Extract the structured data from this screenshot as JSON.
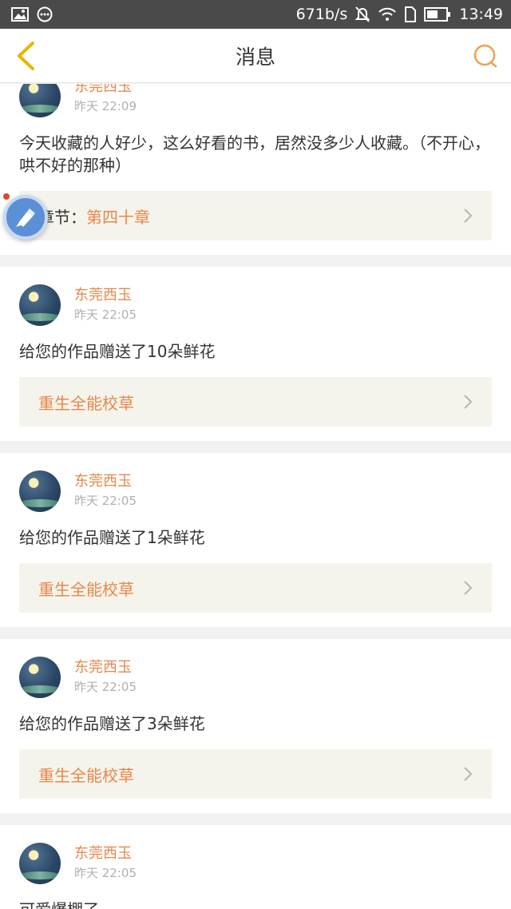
{
  "status_bar": {
    "speed": "671b/s",
    "time": "13:49"
  },
  "header": {
    "title": "消息"
  },
  "colors": {
    "accent": "#e8874a",
    "icon_yellow": "#e6b800",
    "search_orange": "#f0a050"
  },
  "messages": [
    {
      "author": "东莞西玉",
      "time": "昨天 22:09",
      "text": "今天收藏的人好少，这么好看的书，居然没多少人收藏。（不开心，哄不好的那种）",
      "link_label": "章节：",
      "link_value": "第四十章"
    },
    {
      "author": "东莞西玉",
      "time": "昨天 22:05",
      "text": "给您的作品赠送了10朵鲜花",
      "link": "重生全能校草"
    },
    {
      "author": "东莞西玉",
      "time": "昨天 22:05",
      "text": "给您的作品赠送了1朵鲜花",
      "link": "重生全能校草"
    },
    {
      "author": "东莞西玉",
      "time": "昨天 22:05",
      "text": "给您的作品赠送了3朵鲜花",
      "link": "重生全能校草"
    },
    {
      "author": "东莞西玉",
      "time": "昨天 22:05",
      "text": "可爱爆棚了"
    }
  ]
}
